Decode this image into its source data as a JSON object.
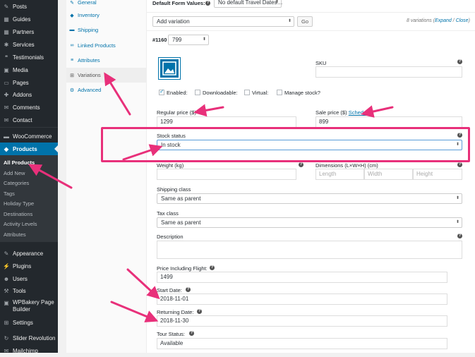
{
  "sidebar": {
    "items": [
      {
        "label": "Posts",
        "icon": "pushpin-icon",
        "glyph": "✎"
      },
      {
        "label": "Guides",
        "icon": "guides-icon",
        "glyph": "▦"
      },
      {
        "label": "Partners",
        "icon": "partners-icon",
        "glyph": "▦"
      },
      {
        "label": "Services",
        "icon": "services-icon",
        "glyph": "✱"
      },
      {
        "label": "Testimonials",
        "icon": "testimonials-icon",
        "glyph": "❝"
      },
      {
        "label": "Media",
        "icon": "media-icon",
        "glyph": "▣"
      },
      {
        "label": "Pages",
        "icon": "pages-icon",
        "glyph": "▭"
      },
      {
        "label": "Addons",
        "icon": "addons-icon",
        "glyph": "✚"
      },
      {
        "label": "Comments",
        "icon": "comments-icon",
        "glyph": "✉"
      },
      {
        "label": "Contact",
        "icon": "contact-icon",
        "glyph": "✉"
      },
      {
        "label": "WooCommerce",
        "icon": "woocommerce-icon",
        "glyph": "▬"
      },
      {
        "label": "Products",
        "icon": "products-icon",
        "glyph": "◆"
      },
      {
        "label": "Appearance",
        "icon": "appearance-icon",
        "glyph": "✎"
      },
      {
        "label": "Plugins",
        "icon": "plugins-icon",
        "glyph": "⚡"
      },
      {
        "label": "Users",
        "icon": "users-icon",
        "glyph": "☻"
      },
      {
        "label": "Tools",
        "icon": "tools-icon",
        "glyph": "⚒"
      },
      {
        "label": "WPBakery Page Builder",
        "icon": "wpbakery-icon",
        "glyph": "▣"
      },
      {
        "label": "Settings",
        "icon": "settings-icon",
        "glyph": "⊞"
      },
      {
        "label": "Slider Revolution",
        "icon": "slider-revolution-icon",
        "glyph": "↻"
      },
      {
        "label": "Mailchimp",
        "icon": "mailchimp-icon",
        "glyph": "✉"
      }
    ],
    "submenu": [
      "All Products",
      "Add New",
      "Categories",
      "Tags",
      "Holiday Type",
      "Destinations",
      "Activity Levels",
      "Attributes"
    ]
  },
  "tabs": [
    {
      "label": "General",
      "icon": "wrench-icon",
      "glyph": "✎"
    },
    {
      "label": "Inventory",
      "icon": "inventory-icon",
      "glyph": "◆"
    },
    {
      "label": "Shipping",
      "icon": "truck-icon",
      "glyph": "▬"
    },
    {
      "label": "Linked Products",
      "icon": "link-icon",
      "glyph": "∞"
    },
    {
      "label": "Attributes",
      "icon": "list-icon",
      "glyph": "≡"
    },
    {
      "label": "Variations",
      "icon": "grid-icon",
      "glyph": "⊞"
    },
    {
      "label": "Advanced",
      "icon": "gear-icon",
      "glyph": "⚙"
    }
  ],
  "toolbar": {
    "default_form_label": "Default Form Values:",
    "default_form_value": "No default Travel Dates…",
    "add_variation": "Add variation",
    "go": "Go",
    "variations_count": "8 variations (",
    "expand": "Expand",
    "sep": " / ",
    "close": "Close",
    "paren_close": ")"
  },
  "variation": {
    "id": "#1160",
    "value": "799",
    "sku_label": "SKU",
    "sku_value": "",
    "enabled": "Enabled:",
    "downloadable": "Downloadable:",
    "virtual": "Virtual:",
    "manage_stock": "Manage stock?",
    "regular_price_label": "Regular price ($)",
    "regular_price": "1299",
    "sale_price_label": "Sale price ($)",
    "schedule": "Schedule",
    "sale_price": "899",
    "stock_status_label": "Stock status",
    "stock_status": "In stock",
    "weight_label": "Weight (kg)",
    "weight": "",
    "dimensions_label": "Dimensions (L×W×H) (cm)",
    "length_ph": "Length",
    "width_ph": "Width",
    "height_ph": "Height",
    "shipping_class_label": "Shipping class",
    "shipping_class": "Same as parent",
    "tax_class_label": "Tax class",
    "tax_class": "Same as parent",
    "description_label": "Description",
    "price_flight_label": "Price Including Flight:",
    "price_flight": "1499",
    "start_date_label": "Start Date:",
    "start_date": "2018-11-01",
    "returning_date_label": "Returning Date:",
    "returning_date": "2018-11-30",
    "tour_status_label": "Tour Status:",
    "tour_status": "Available",
    "help": "?"
  },
  "colors": {
    "accent": "#0073aa",
    "highlight": "#e8307a",
    "sidebar": "#23282d"
  }
}
